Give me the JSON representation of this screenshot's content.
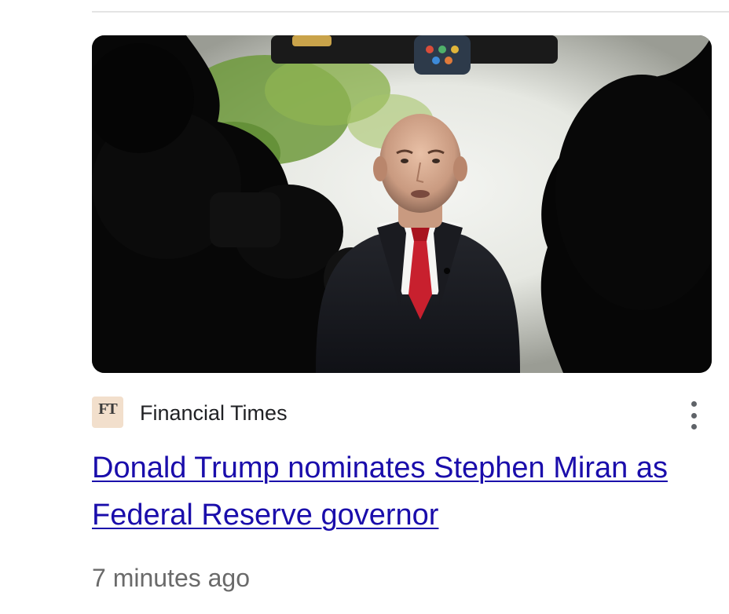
{
  "article": {
    "image_alt": "Man in dark suit and red tie speaking to cameras outdoors",
    "source": {
      "logo_text": "FT",
      "name": "Financial Times"
    },
    "more_options_icon": "three-dot-vertical-icon",
    "headline": "Donald Trump nominates Stephen Miran as Federal Reserve governor",
    "timestamp": "7 minutes ago"
  },
  "colors": {
    "link": "#1a0dab",
    "source_logo_bg": "#f2dfcc",
    "timestamp": "#6a6a6a",
    "tie": "#c8202e"
  }
}
